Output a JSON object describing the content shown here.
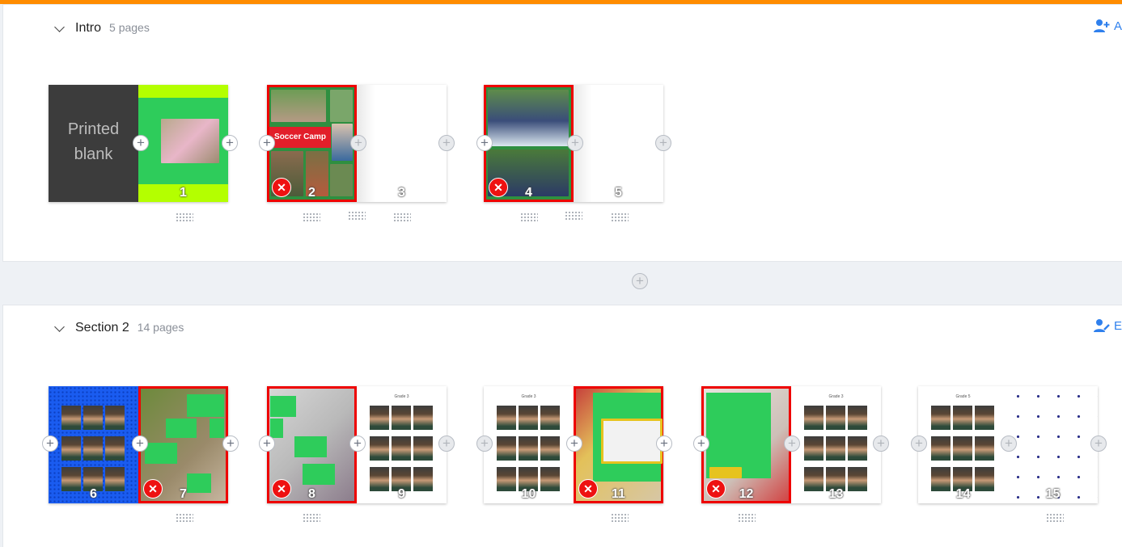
{
  "colors": {
    "accent": "#ff8c00",
    "error": "#e11111",
    "link": "#2f80ed"
  },
  "sections": [
    {
      "title": "Intro",
      "count": "5 pages",
      "action_label": "A"
    },
    {
      "title": "Section 2",
      "count": "14 pages",
      "action_label": "E"
    }
  ],
  "pages": {
    "p1": "1",
    "p2": "2",
    "p3": "3",
    "p4": "4",
    "p5": "5",
    "p6": "6",
    "p7": "7",
    "p8": "8",
    "p9": "9",
    "p10": "10",
    "p11": "11",
    "p12": "12",
    "p13": "13",
    "p14": "14",
    "p15": "15"
  },
  "printed_blank": "Printed blank",
  "soccer_title": "Soccer Camp",
  "grade_label": "Grade 3",
  "grade_label_5": "Grade 5",
  "icons": {
    "expand": "chevron-down-icon",
    "add": "plus-icon",
    "warning": "broken-link-icon",
    "drag": "drag-handle-icon",
    "user": "user-add-icon"
  }
}
